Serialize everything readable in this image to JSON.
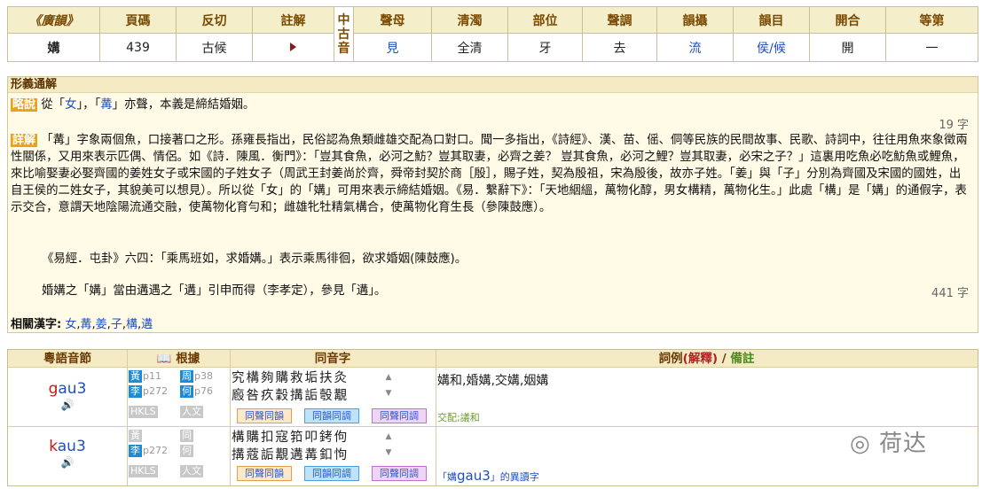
{
  "top": {
    "headers": [
      "《廣韻》",
      "頁碼",
      "反切",
      "註解",
      "中古音",
      "聲母",
      "清濁",
      "部位",
      "聲調",
      "韻攝",
      "韻目",
      "開合",
      "等第"
    ],
    "values": {
      "char": "媾",
      "page": "439",
      "fanqie": "古候",
      "shengmu": "見",
      "qingzhuo": "全清",
      "buwei": "牙",
      "shengdiao": "去",
      "yunshe": "流",
      "yunmu": "侯/候",
      "kaihe": "開",
      "dengdi": "一"
    }
  },
  "mid": {
    "title": "形義通解",
    "brief_tag": "略說",
    "brief_text": "從「女」，「冓」亦聲，本義是締結婚姻。",
    "brief_count": "19 字",
    "detail_tag": "詳解",
    "detail_p1": "「冓」字象兩個魚，口接著口之形。孫雍長指出，民俗認為魚類雌雄交配為口對口。聞一多指出，《詩經》、漢、苗、傜、侗等民族的民間故事、民歌、詩詞中，往往用魚來象徵兩性關係，又用來表示匹偶、情侶。如《詩．陳風．衡門》：「豈其食魚，必河之魴？豈其取妻，必齊之姜？ 豈其食魚，必河之鯉？豈其取妻，必宋之子？」這裏用吃魚必吃魴魚或鯉魚，來比喻娶妻必娶齊國的姜姓女子或宋國的子姓女子（周武王封姜尚於齊，舜帝封契於商［殷］，賜子姓，契為殷祖，宋為殷後，故亦子姓。「姜」與「子」分別為齊國及宋國的國姓，出自王侯的二姓女子，其貌美可以想見）。所以從「女」的「媾」可用來表示締結婚姻。《易．繫辭下》：「天地絪縕，萬物化醇，男女構精，萬物化生。」此處「構」是「媾」的通假字，表示交合，意謂天地陰陽流通交融，使萬物化育勻和；雌雄牝牡精氣構合，使萬物化育生長（參陳鼓應）。",
    "detail_p2": "《易經．屯卦》六四：「乘馬班如，求婚媾。」表示乘馬徘徊，欲求婚姻(陳鼓應)。",
    "detail_p3": "婚媾之「媾」當由遘遇之「遘」引申而得（李孝定），參見「遘」。",
    "detail_count": "441 字",
    "related_label": "相關漢字:",
    "related": [
      "女",
      "冓",
      "姜",
      "子",
      "構",
      "遘"
    ]
  },
  "bottom": {
    "headers": {
      "yue": "粵語音節",
      "basis": "根據",
      "homo": "同音字",
      "examples": "詞例",
      "explain": "(解釋)",
      "slash": " / ",
      "remark": "備註"
    },
    "rows": [
      {
        "syllable_initial": "g",
        "syllable_rest": "au3",
        "src": [
          [
            "黃",
            "p11",
            "周",
            "p38"
          ],
          [
            "李",
            "p272",
            "何",
            "p76"
          ],
          [
            "HKLS",
            "",
            "人文",
            ""
          ]
        ],
        "homo1": "究構夠購救垢扶灸",
        "homo2": "廏咎疚穀搆詬彀覯",
        "buttons": [
          "同聲同韻",
          "同韻同調",
          "同聲同調"
        ],
        "examples": "媾和,婚媾,交媾,姻媾",
        "note": "交配;議和"
      },
      {
        "syllable_initial": "k",
        "syllable_rest": "au3",
        "src": [
          [
            "黃",
            "",
            "同",
            ""
          ],
          [
            "李",
            "p272",
            "何",
            ""
          ],
          [
            "HKLS",
            "",
            "人文",
            ""
          ]
        ],
        "homo1": "構購扣寇筘叩銬佝",
        "homo2": "搆蔻詬覯遘冓釦怐",
        "buttons": [
          "同聲同韻",
          "同韻同調",
          "同聲同調"
        ],
        "examples": "",
        "note_pre": "「媾",
        "note_big": "gau3",
        "note_post": "」的異讀字"
      }
    ]
  },
  "watermark": "荷达",
  "colors": {
    "header_bg": "#f4eac4",
    "link": "#1f4fbf",
    "tag": "#e8a31a",
    "red": "#c01818"
  }
}
